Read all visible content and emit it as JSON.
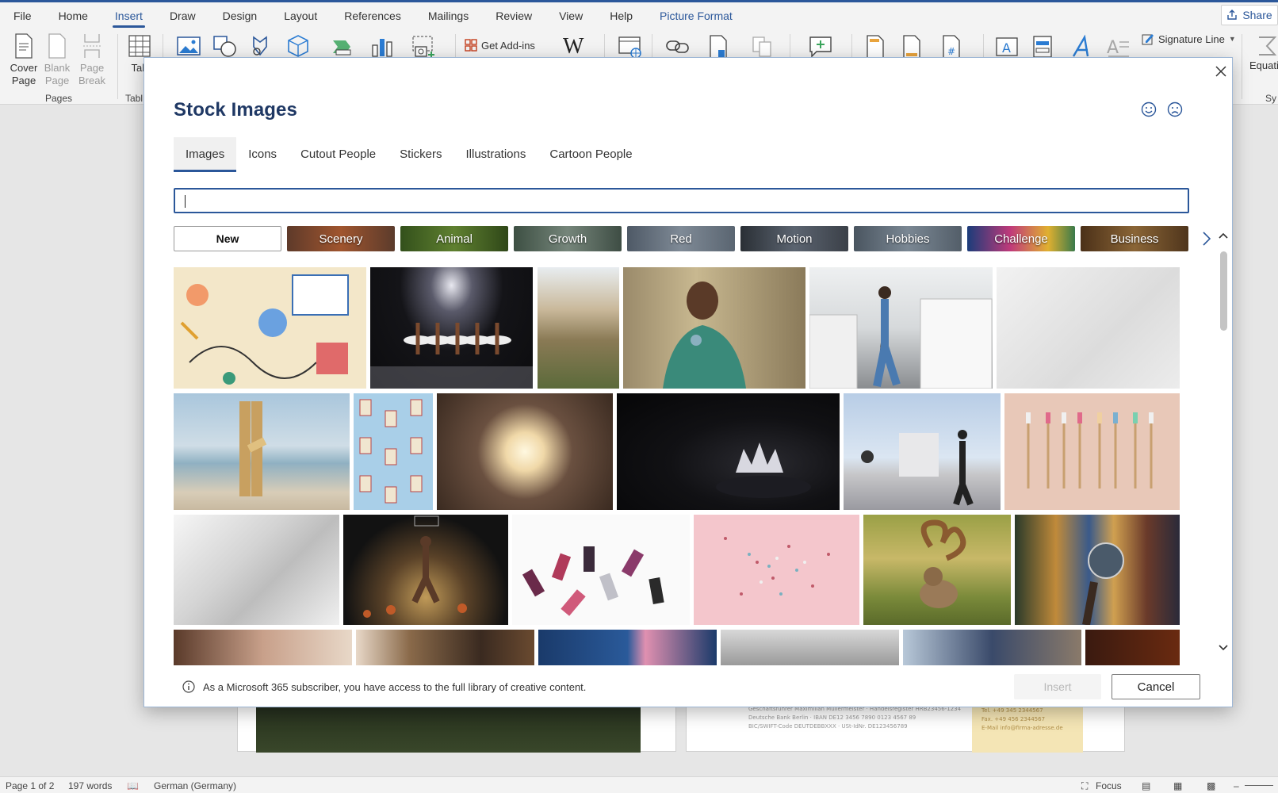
{
  "ribbon_tabs": [
    "File",
    "Home",
    "Insert",
    "Draw",
    "Design",
    "Layout",
    "References",
    "Mailings",
    "Review",
    "View",
    "Help",
    "Picture Format"
  ],
  "share_label": "Share",
  "ribbon": {
    "cover_page": "Cover Page",
    "blank_page": "Blank Page",
    "page_break": "Page Break",
    "table": "Tab",
    "pages_group": "Pages",
    "table_group": "Tabl",
    "get_addins": "Get Add-ins",
    "signature_line": "Signature Line",
    "equation": "Equatio",
    "symbols_group": "Sy"
  },
  "dialog": {
    "title": "Stock Images",
    "tabs": [
      "Images",
      "Icons",
      "Cutout People",
      "Stickers",
      "Illustrations",
      "Cartoon People"
    ],
    "active_tab": "Images",
    "search_value": "",
    "categories": [
      "New",
      "Scenery",
      "Animal",
      "Growth",
      "Red",
      "Motion",
      "Hobbies",
      "Challenge",
      "Business"
    ],
    "category_colors": [
      "#ffffff",
      "#8a4a2e",
      "#4e6b2a",
      "#54635a",
      "#6e7884",
      "#3f4650",
      "#5d6873",
      "#8d3a6a",
      "#6a4a2a"
    ],
    "info_text": "As a Microsoft 365 subscriber, you have access to the full library of creative content.",
    "insert_label": "Insert",
    "cancel_label": "Cancel"
  },
  "document": {
    "letter_lines": [
      "Geschäftsführer Maximilian Müllermeister · Handelsregister HRB23456-1234",
      "Deutsche Bank Berlin · IBAN DE12 3456 7890 0123 4567 89",
      "BIC/SWIFT-Code DEUTDEBBXXX · USt-IdNr. DE123456789"
    ],
    "letter_contact": [
      "Tel. +49 345 2344567",
      "Fax. +49 456 2344567",
      "E-Mail info@firma-adresse.de"
    ]
  },
  "status": {
    "page": "Page 1 of 2",
    "words": "197 words",
    "language": "German (Germany)",
    "focus": "Focus"
  }
}
